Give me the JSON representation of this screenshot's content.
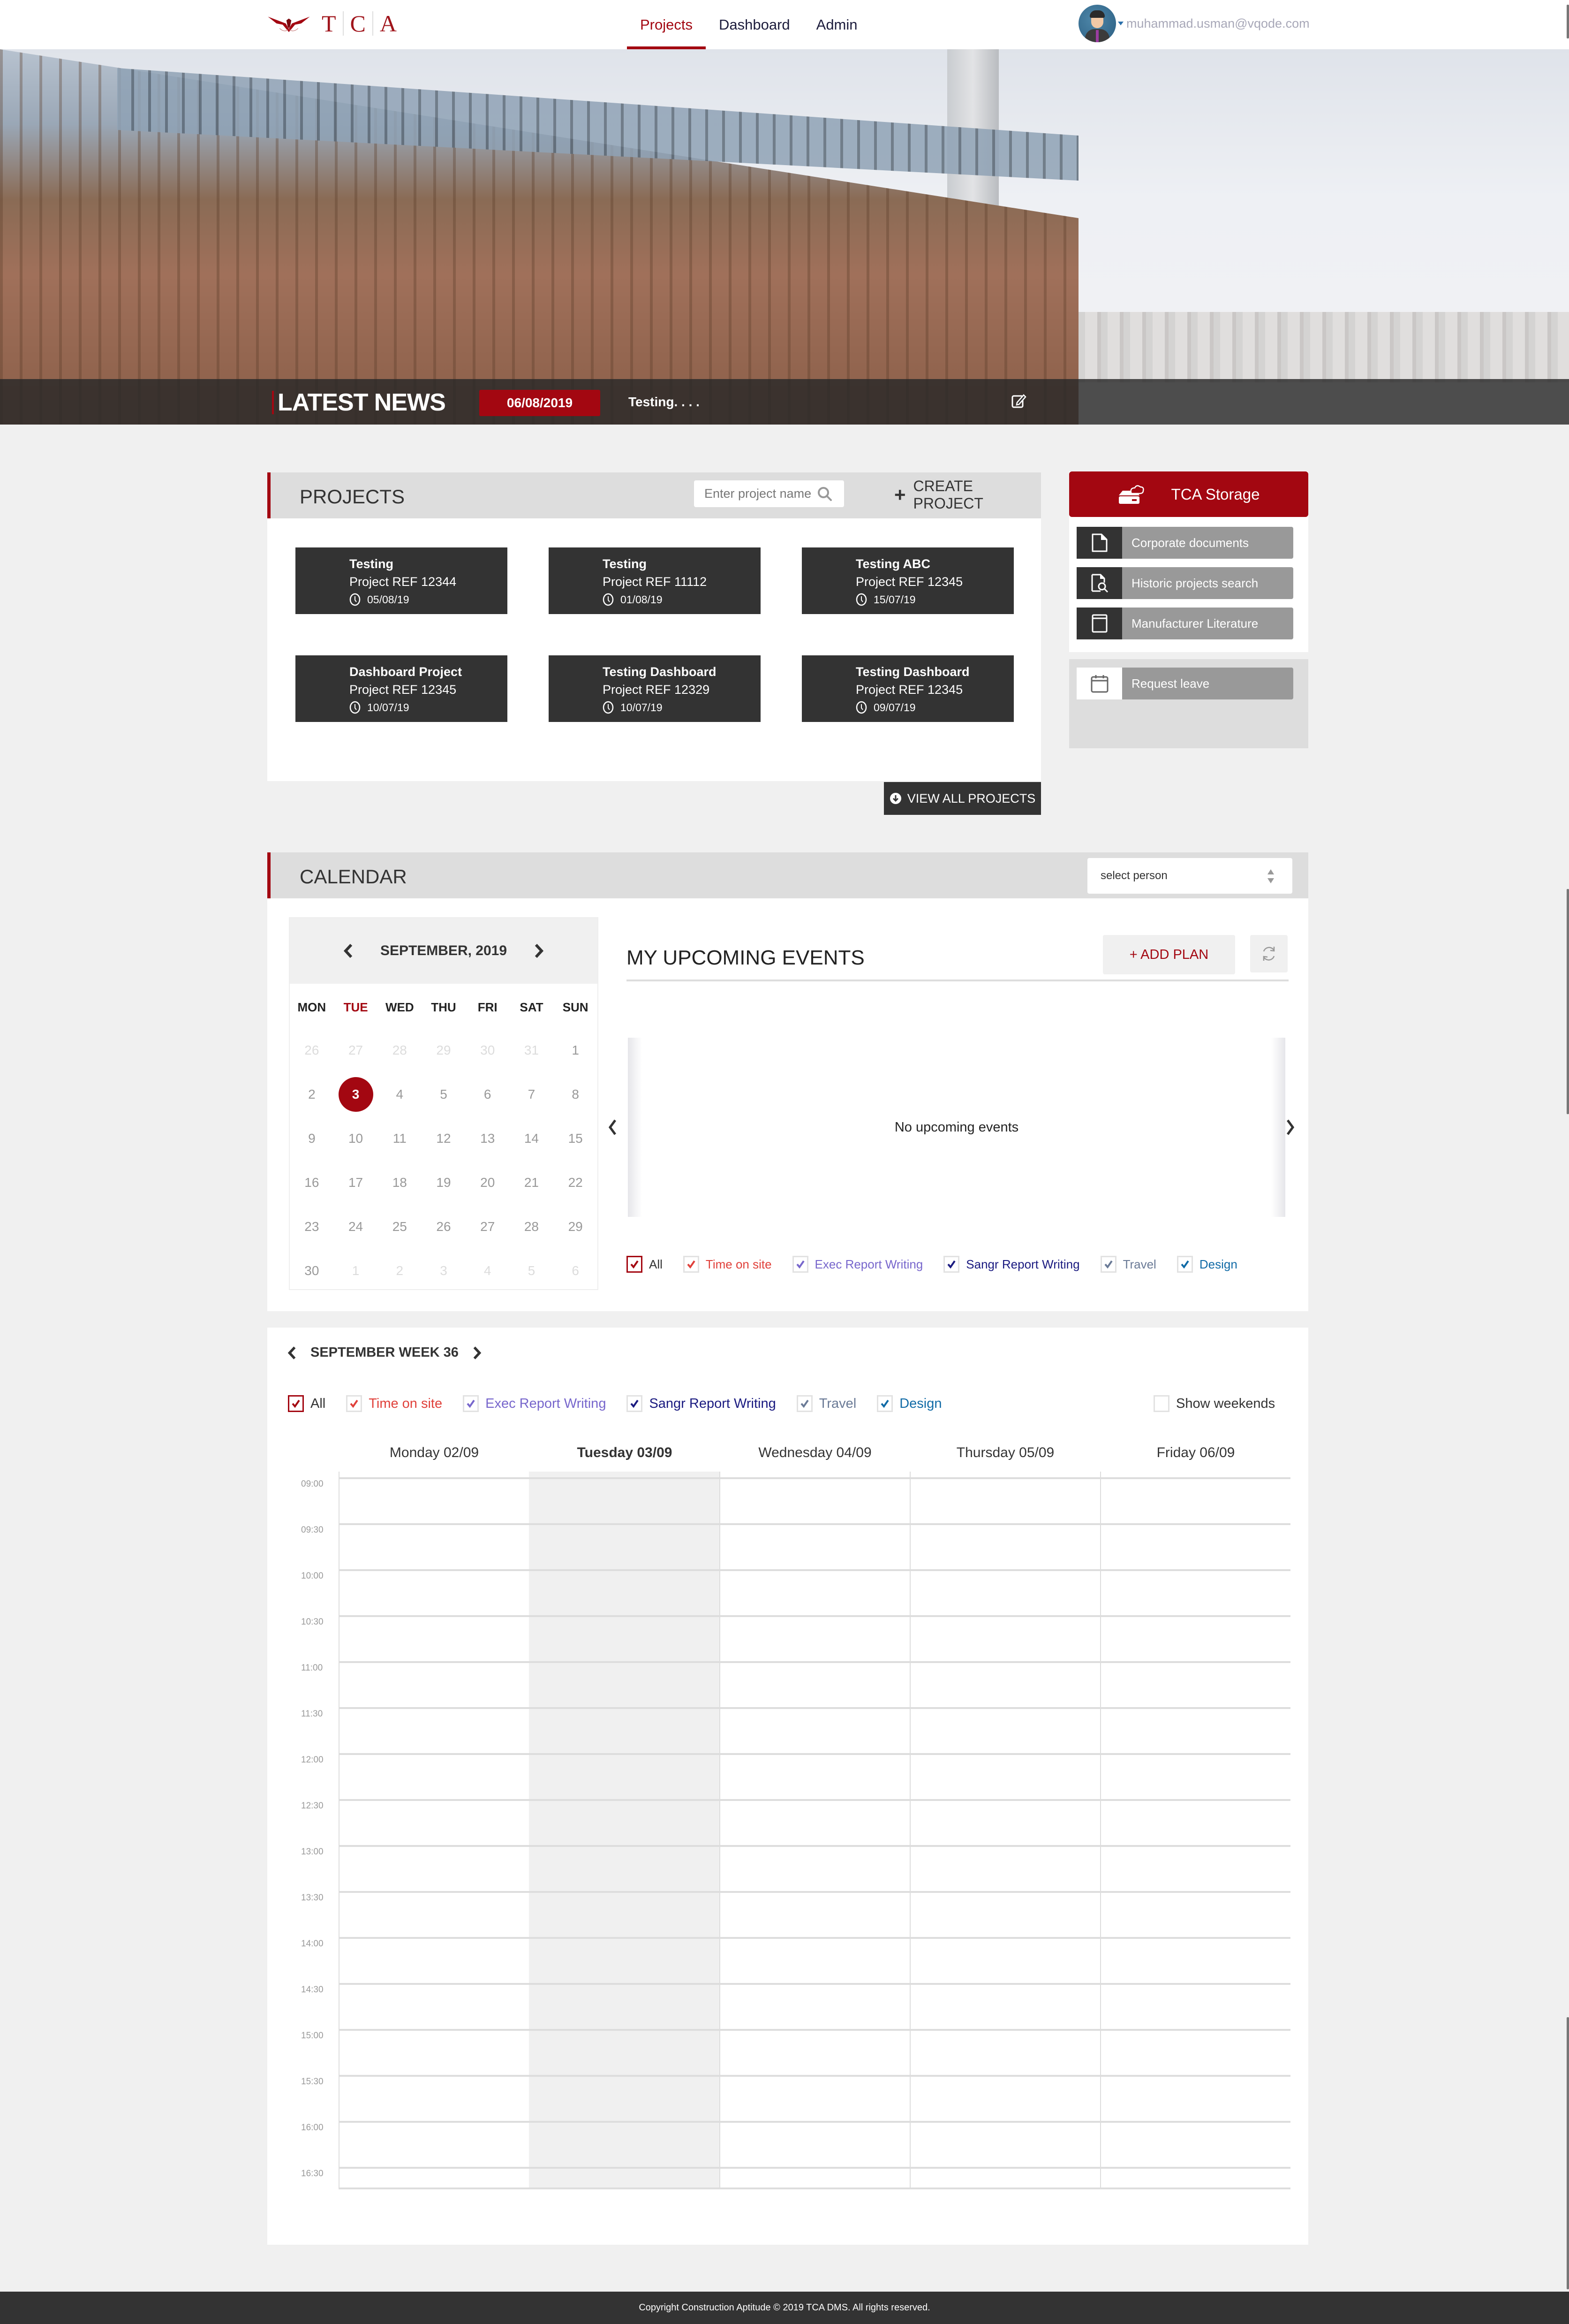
{
  "header": {
    "logo_letters": [
      "T",
      "C",
      "A"
    ],
    "nav": [
      {
        "label": "Projects",
        "active": true
      },
      {
        "label": "Dashboard",
        "active": false
      },
      {
        "label": "Admin",
        "active": false
      }
    ],
    "user_email": "muhammad.usman@vqode.com"
  },
  "news": {
    "title": "LATEST NEWS",
    "date": "06/08/2019",
    "text": "Testing. . . ."
  },
  "projects": {
    "title": "PROJECTS",
    "search_placeholder": "Enter project name",
    "create_label": "CREATE PROJECT",
    "view_all_label": "VIEW ALL PROJECTS",
    "items": [
      {
        "name": "Testing",
        "ref": "Project REF 12344",
        "date": "05/08/19"
      },
      {
        "name": "Testing",
        "ref": "Project REF 11112",
        "date": "01/08/19"
      },
      {
        "name": "Testing ABC",
        "ref": "Project REF 12345",
        "date": "15/07/19"
      },
      {
        "name": "Dashboard Project",
        "ref": "Project REF 12345",
        "date": "10/07/19"
      },
      {
        "name": "Testing Dashboard",
        "ref": "Project REF 12329",
        "date": "10/07/19"
      },
      {
        "name": "Testing Dashboard",
        "ref": "Project REF 12345",
        "date": "09/07/19"
      }
    ]
  },
  "storage": {
    "title": "TCA Storage",
    "items": [
      {
        "label": "Corporate documents",
        "icon": "document-icon"
      },
      {
        "label": "Historic projects search",
        "icon": "document-search-icon"
      },
      {
        "label": "Manufacturer Literature",
        "icon": "book-icon"
      }
    ],
    "request_leave": "Request leave"
  },
  "calendar": {
    "title": "CALENDAR",
    "select_person": "select person",
    "month_label": "SEPTEMBER, 2019",
    "weekdays": [
      "MON",
      "TUE",
      "WED",
      "THU",
      "FRI",
      "SAT",
      "SUN"
    ],
    "today_weekday_index": 1,
    "days": [
      {
        "d": "26",
        "other": true
      },
      {
        "d": "27",
        "other": true
      },
      {
        "d": "28",
        "other": true
      },
      {
        "d": "29",
        "other": true
      },
      {
        "d": "30",
        "other": true
      },
      {
        "d": "31",
        "other": true
      },
      {
        "d": "1"
      },
      {
        "d": "2"
      },
      {
        "d": "3",
        "selected": true
      },
      {
        "d": "4"
      },
      {
        "d": "5"
      },
      {
        "d": "6"
      },
      {
        "d": "7"
      },
      {
        "d": "8"
      },
      {
        "d": "9"
      },
      {
        "d": "10"
      },
      {
        "d": "11"
      },
      {
        "d": "12"
      },
      {
        "d": "13"
      },
      {
        "d": "14"
      },
      {
        "d": "15"
      },
      {
        "d": "16"
      },
      {
        "d": "17"
      },
      {
        "d": "18"
      },
      {
        "d": "19"
      },
      {
        "d": "20"
      },
      {
        "d": "21"
      },
      {
        "d": "22"
      },
      {
        "d": "23"
      },
      {
        "d": "24"
      },
      {
        "d": "25"
      },
      {
        "d": "26"
      },
      {
        "d": "27"
      },
      {
        "d": "28"
      },
      {
        "d": "29"
      },
      {
        "d": "30"
      },
      {
        "d": "1",
        "other": true
      },
      {
        "d": "2",
        "other": true
      },
      {
        "d": "3",
        "other": true
      },
      {
        "d": "4",
        "other": true
      },
      {
        "d": "5",
        "other": true
      },
      {
        "d": "6",
        "other": true
      }
    ],
    "events_title": "MY UPCOMING EVENTS",
    "add_plan": "+ ADD PLAN",
    "no_events": "No upcoming events",
    "filters": [
      {
        "label": "All",
        "color": "#333333",
        "check": "#a30711",
        "checked": true
      },
      {
        "label": "Time on site",
        "color": "#e0403a",
        "check": "#e0403a",
        "checked": true
      },
      {
        "label": "Exec Report Writing",
        "color": "#7766cc",
        "check": "#7766cc",
        "checked": true
      },
      {
        "label": "Sangr Report Writing",
        "color": "#1a1a80",
        "check": "#1a1a80",
        "checked": true
      },
      {
        "label": "Travel",
        "color": "#6a7a96",
        "check": "#6a7a96",
        "checked": true
      },
      {
        "label": "Design",
        "color": "#106aa6",
        "check": "#106aa6",
        "checked": true
      }
    ]
  },
  "week": {
    "label": "SEPTEMBER WEEK 36",
    "show_weekends": "Show weekends",
    "show_weekends_checked": false,
    "days": [
      {
        "label": "Monday 02/09",
        "today": false
      },
      {
        "label": "Tuesday 03/09",
        "today": true
      },
      {
        "label": "Wednesday 04/09",
        "today": false
      },
      {
        "label": "Thursday 05/09",
        "today": false
      },
      {
        "label": "Friday 06/09",
        "today": false
      }
    ],
    "times": [
      "09:00",
      "09:30",
      "10:00",
      "10:30",
      "11:00",
      "11:30",
      "12:00",
      "12:30",
      "13:00",
      "13:30",
      "14:00",
      "14:30",
      "15:00",
      "15:30",
      "16:00",
      "16:30"
    ]
  },
  "footer": {
    "text": "Copyright Construction Aptitude © 2019 TCA DMS. All rights reserved."
  },
  "colors": {
    "brand": "#a30711",
    "dark": "#333333",
    "panel_gray": "#dddddd",
    "page_bg": "#f0f0f0"
  }
}
